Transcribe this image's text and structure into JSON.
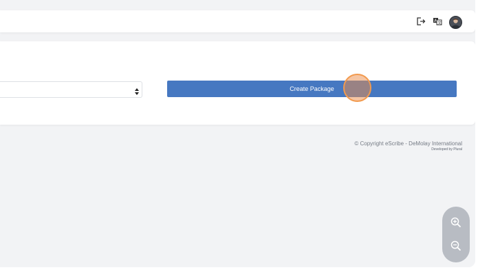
{
  "header": {
    "icons": [
      "logout-icon",
      "translate-icon",
      "user-avatar"
    ]
  },
  "form": {
    "select_value": "",
    "create_button_label": "Create Package"
  },
  "footer": {
    "copyright": "© Copyright eScribe - DeMolay International",
    "developed_by": "Developed by Plural"
  },
  "zoom": {
    "icons": [
      "zoom-in-icon",
      "zoom-out-icon"
    ]
  },
  "colors": {
    "background": "#f2f3f5",
    "primary_button": "#4678c1",
    "click_highlight": "#f29a4e",
    "zoom_panel": "#b8bcc3"
  }
}
